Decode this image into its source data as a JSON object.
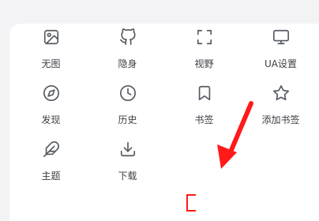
{
  "menu": {
    "items": [
      {
        "name": "no-image",
        "icon": "image-icon",
        "label": "无图"
      },
      {
        "name": "incognito",
        "icon": "github-icon",
        "label": "隐身"
      },
      {
        "name": "viewport",
        "icon": "frame-corners-icon",
        "label": "视野"
      },
      {
        "name": "ua-settings",
        "icon": "monitor-icon",
        "label": "UA设置"
      },
      {
        "name": "discover",
        "icon": "compass-icon",
        "label": "发现"
      },
      {
        "name": "history",
        "icon": "clock-icon",
        "label": "历史"
      },
      {
        "name": "bookmarks",
        "icon": "bookmark-icon",
        "label": "书签"
      },
      {
        "name": "add-bookmark",
        "icon": "star-icon",
        "label": "添加书签"
      },
      {
        "name": "theme",
        "icon": "feather-icon",
        "label": "主题"
      },
      {
        "name": "downloads",
        "icon": "download-icon",
        "label": "下载"
      }
    ]
  },
  "annotation": {
    "arrow_color": "#ff1a1a",
    "highlight_color": "#ff1a1a"
  }
}
